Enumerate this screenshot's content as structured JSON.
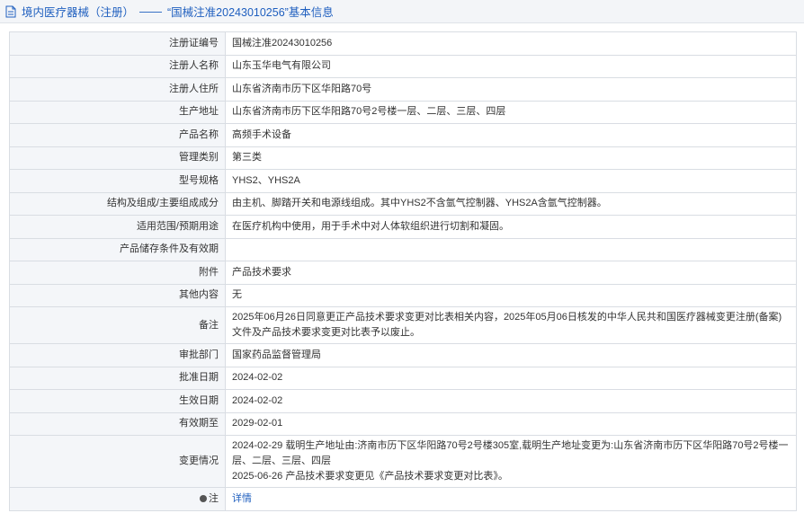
{
  "header": {
    "breadcrumb": "境内医疗器械（注册）",
    "separator": "——",
    "title": "“国械注准20243010256”基本信息"
  },
  "rows": [
    {
      "label": "注册证编号",
      "value": "国械注准20243010256"
    },
    {
      "label": "注册人名称",
      "value": "山东玉华电气有限公司"
    },
    {
      "label": "注册人住所",
      "value": "山东省济南市历下区华阳路70号"
    },
    {
      "label": "生产地址",
      "value": "山东省济南市历下区华阳路70号2号楼一层、二层、三层、四层"
    },
    {
      "label": "产品名称",
      "value": "高频手术设备"
    },
    {
      "label": "管理类别",
      "value": "第三类"
    },
    {
      "label": "型号规格",
      "value": "YHS2、YHS2A"
    },
    {
      "label": "结构及组成/主要组成成分",
      "value": "由主机、脚踏开关和电源线组成。其中YHS2不含氩气控制器、YHS2A含氩气控制器。"
    },
    {
      "label": "适用范围/预期用途",
      "value": "在医疗机构中使用，用于手术中对人体软组织进行切割和凝固。"
    },
    {
      "label": "产品储存条件及有效期",
      "value": ""
    },
    {
      "label": "附件",
      "value": "产品技术要求"
    },
    {
      "label": "其他内容",
      "value": "无"
    },
    {
      "label": "备注",
      "value": "2025年06月26日同意更正产品技术要求变更对比表相关内容，2025年05月06日核发的中华人民共和国医疗器械变更注册(备案)文件及产品技术要求变更对比表予以废止。"
    },
    {
      "label": "审批部门",
      "value": "国家药品监督管理局"
    },
    {
      "label": "批准日期",
      "value": "2024-02-02"
    },
    {
      "label": "生效日期",
      "value": "2024-02-02"
    },
    {
      "label": "有效期至",
      "value": "2029-02-01"
    },
    {
      "label": "变更情况",
      "value_line1": "2024-02-29 载明生产地址由:济南市历下区华阳路70号2号楼305室,载明生产地址变更为:山东省济南市历下区华阳路70号2号楼一层、二层、三层、四层",
      "value_line2": "2025-06-26 产品技术要求变更见《产品技术要求变更对比表》。"
    }
  ],
  "footnote": {
    "label": "注",
    "link": "详情"
  }
}
